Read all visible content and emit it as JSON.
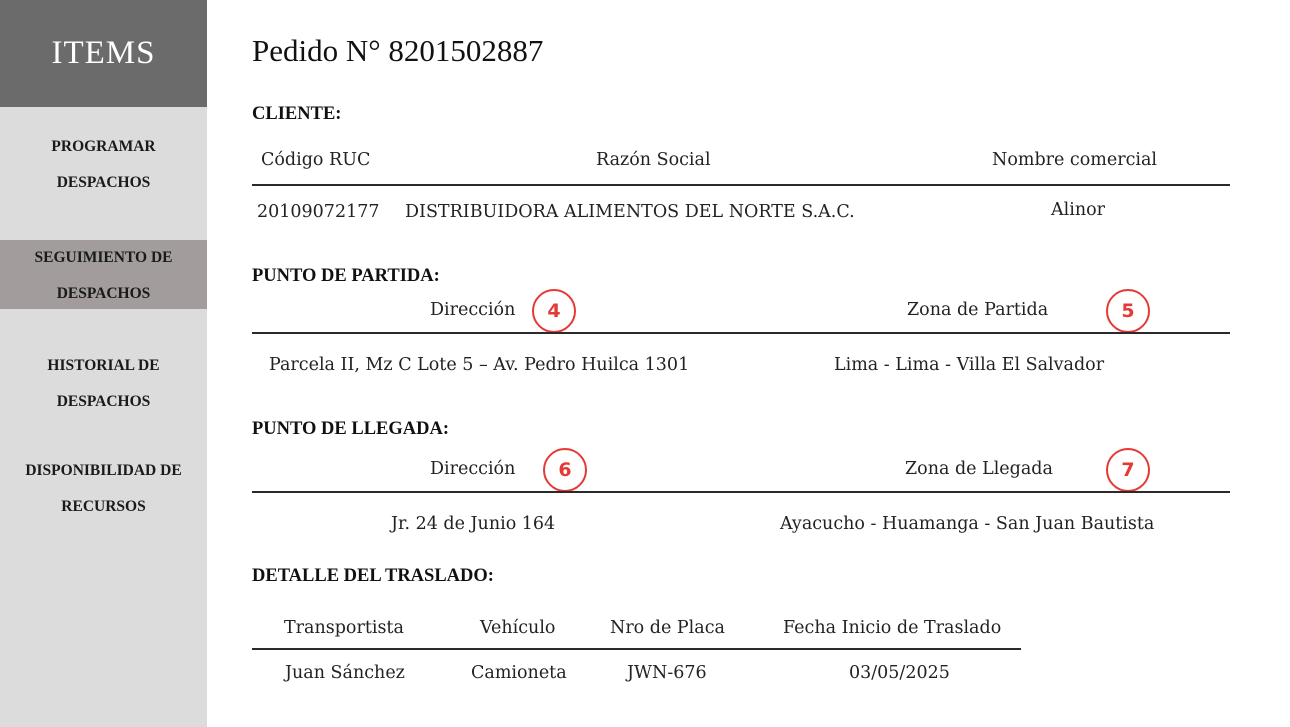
{
  "sidebar": {
    "header": "ITEMS",
    "items": [
      {
        "line1": "PROGRAMAR",
        "line2": "DESPACHOS"
      },
      {
        "line1": "SEGUIMIENTO DE",
        "line2": "DESPACHOS"
      },
      {
        "line1": "HISTORIAL DE",
        "line2": "DESPACHOS"
      },
      {
        "line1": "DISPONIBILIDAD DE",
        "line2": "RECURSOS"
      }
    ],
    "active_index": 1
  },
  "page": {
    "title": "Pedido N° 8201502887"
  },
  "cliente": {
    "heading": "CLIENTE:",
    "headers": {
      "ruc": "Código RUC",
      "razon": "Razón Social",
      "nombre": "Nombre comercial"
    },
    "values": {
      "ruc": "20109072177",
      "razon": "DISTRIBUIDORA ALIMENTOS DEL NORTE S.A.C.",
      "nombre": "Alinor"
    }
  },
  "partida": {
    "heading": "PUNTO DE PARTIDA:",
    "headers": {
      "direccion": "Dirección",
      "zona": "Zona de Partida"
    },
    "values": {
      "direccion": "Parcela II, Mz C Lote 5 – Av. Pedro Huilca 1301",
      "zona": "Lima - Lima - Villa El Salvador"
    },
    "badges": {
      "direccion": "4",
      "zona": "5"
    }
  },
  "llegada": {
    "heading": "PUNTO DE LLEGADA:",
    "headers": {
      "direccion": "Dirección",
      "zona": "Zona de Llegada"
    },
    "values": {
      "direccion": "Jr. 24 de Junio 164",
      "zona": "Ayacucho - Huamanga - San Juan Bautista"
    },
    "badges": {
      "direccion": "6",
      "zona": "7"
    }
  },
  "traslado": {
    "heading": "DETALLE DEL TRASLADO:",
    "headers": {
      "transportista": "Transportista",
      "vehiculo": "Vehículo",
      "placa": "Nro de Placa",
      "fecha": "Fecha Inicio de Traslado"
    },
    "values": {
      "transportista": "Juan Sánchez",
      "vehiculo": "Camioneta",
      "placa": "JWN-676",
      "fecha": "03/05/2025"
    }
  },
  "colors": {
    "badge": "#e53935",
    "sidebar_bg": "#dcdcdc",
    "sidebar_header": "#6b6b6b",
    "active_item": "#a29c9c"
  }
}
